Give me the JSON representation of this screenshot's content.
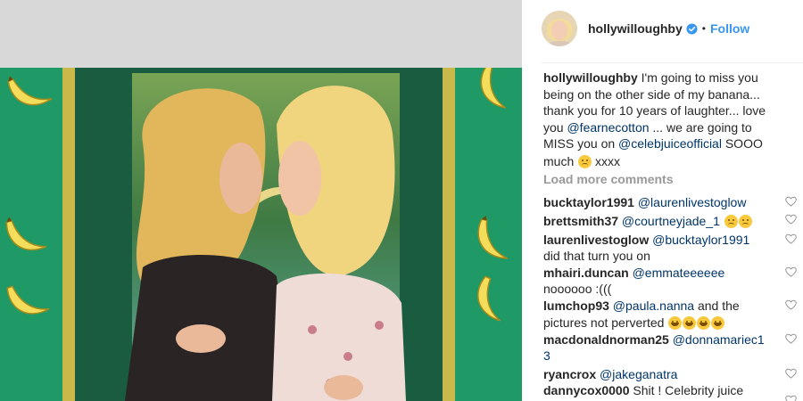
{
  "post": {
    "username": "hollywilloughby",
    "follow_label": "Follow",
    "separator": "•"
  },
  "caption": {
    "username": "hollywilloughby",
    "text_1": " I'm going to miss you being on the other side of my banana... thank you for 10 years of laughter... love you ",
    "mention_1": "@fearnecotton",
    "text_2": " ... we are going to MISS you on ",
    "mention_2": "@celebjuiceofficial",
    "text_3": " SOOO much ",
    "text_4": " xxxx"
  },
  "load_more": "Load more comments",
  "comments": [
    {
      "username": "bucktaylor1991",
      "mention": "@laurenlivestoglow",
      "text": ""
    },
    {
      "username": "brettsmith37",
      "mention": "@courtneyjade_1",
      "text": ""
    },
    {
      "username": "laurenlivestoglow",
      "mention": "@bucktaylor1991",
      "text": " did that turn you on"
    },
    {
      "username": "mhairi.duncan",
      "mention": "@emmateeeeee",
      "text": " noooooo :((("
    },
    {
      "username": "lumchop93",
      "mention": "@paula.nanna",
      "text": " and the pictures not perverted "
    },
    {
      "username": "macdonaldnorman25",
      "mention": "@donnamariec13",
      "text": ""
    },
    {
      "username": "ryancrox",
      "mention": "@jakeganatra",
      "text": ""
    },
    {
      "username": "dannycox0000",
      "mention": "",
      "text": " Shit ! Celebrity juice"
    }
  ],
  "icons": {
    "verified": "verified-badge-icon",
    "heart": "heart-outline-icon",
    "sad_emoji": "sad-face-emoji",
    "laugh_emoji": "laughing-face-emoji"
  },
  "colors": {
    "link_blue": "#3897f0",
    "mention": "#003569",
    "muted": "#999999",
    "photo_green": "#1f9a67"
  }
}
